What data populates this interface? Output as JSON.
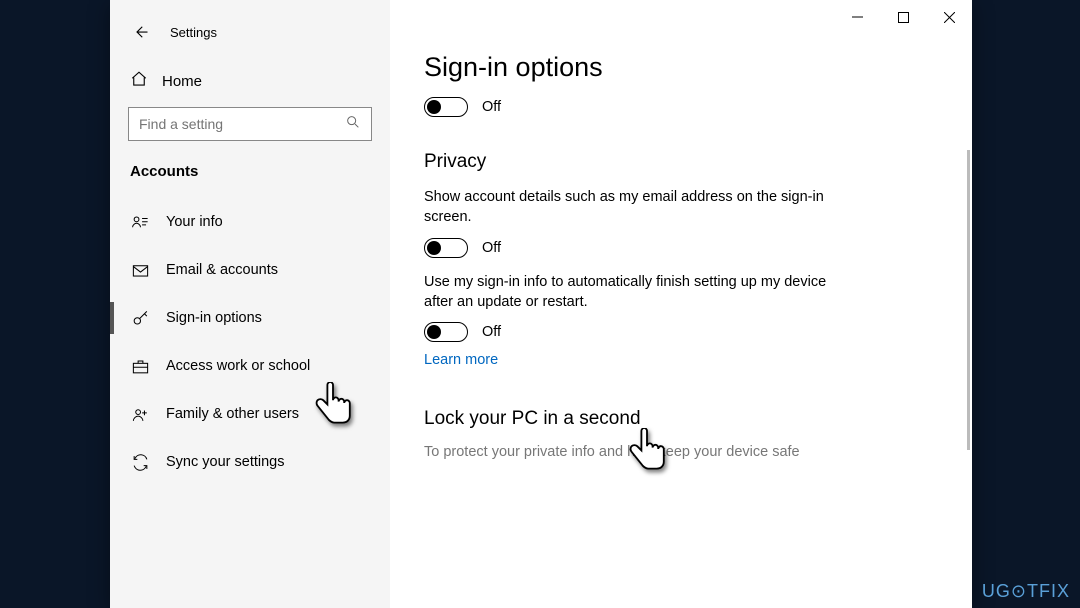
{
  "window": {
    "title": "Settings"
  },
  "sidebar": {
    "home_label": "Home",
    "search_placeholder": "Find a setting",
    "section_header": "Accounts",
    "items": [
      {
        "label": "Your info"
      },
      {
        "label": "Email & accounts"
      },
      {
        "label": "Sign-in options"
      },
      {
        "label": "Access work or school"
      },
      {
        "label": "Family & other users"
      },
      {
        "label": "Sync your settings"
      }
    ]
  },
  "content": {
    "h1": "Sign-in options",
    "toggle1_state": "Off",
    "privacy_header": "Privacy",
    "privacy_desc1": "Show account details such as my email address on the sign-in screen.",
    "toggle2_state": "Off",
    "privacy_desc2": "Use my sign-in info to automatically finish setting up my device after an update or restart.",
    "toggle3_state": "Off",
    "learn_more": "Learn more",
    "lock_header": "Lock your PC in a second",
    "lock_desc_partial": "To protect your private info and help keep your device safe"
  },
  "watermark": "UG⊙TFIX"
}
